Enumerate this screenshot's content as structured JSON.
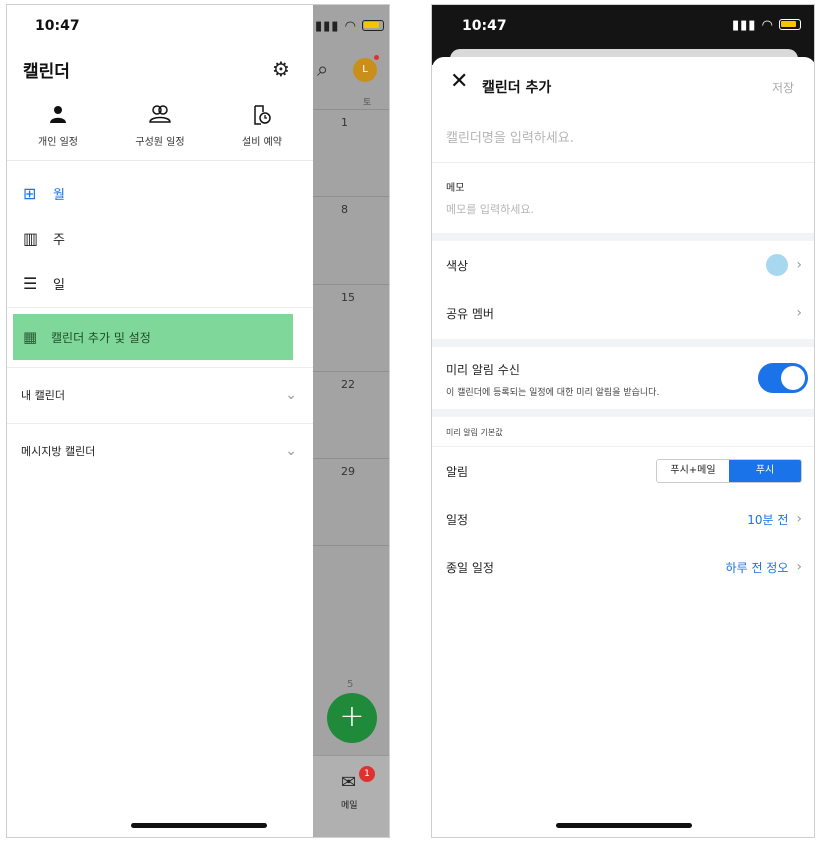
{
  "left": {
    "status": {
      "time": "10:47",
      "signal": "..ıl",
      "wifi": "◡"
    },
    "drawer": {
      "title": "캘린더",
      "shortcuts": [
        {
          "icon": "person-icon",
          "label": "개인 일정"
        },
        {
          "icon": "group-icon",
          "label": "구성원 일정"
        },
        {
          "icon": "equipment-icon",
          "label": "설비 예약"
        }
      ],
      "views": [
        {
          "icon": "month-view-icon",
          "label": "월",
          "active": true
        },
        {
          "icon": "week-view-icon",
          "label": "주",
          "active": false
        },
        {
          "icon": "day-view-icon",
          "label": "일",
          "active": false
        }
      ],
      "add_settings": "캘린더 추가 및 설정",
      "sections": [
        "내 캘린더",
        "메시지방 캘린더"
      ]
    },
    "background": {
      "avatar_initial": "L",
      "day_header": "토",
      "week_dates": [
        "1",
        "8",
        "15",
        "22",
        "29"
      ],
      "next_date": "5",
      "fab": "+",
      "mail_label": "메일",
      "mail_badge": "1"
    }
  },
  "right": {
    "status": {
      "time": "10:47"
    },
    "header": {
      "title": "캘린더 추가",
      "save": "저장"
    },
    "name_placeholder": "캘린더명을 입력하세요.",
    "memo": {
      "label": "메모",
      "placeholder": "메모를 입력하세요."
    },
    "color": {
      "label": "색상",
      "value": "#a8d8f0"
    },
    "share": {
      "label": "공유 멤버"
    },
    "notify": {
      "title": "미리 알림 수신",
      "desc": "이 캘린더에 등록되는 일정에 대한 미리 알림을 받습니다.",
      "enabled": true
    },
    "defaults_header": "미리 알림 기본값",
    "alarm": {
      "label": "알림",
      "options": [
        "푸시+메일",
        "푸시"
      ],
      "selected": "푸시"
    },
    "schedule": {
      "label": "일정",
      "value": "10분 전"
    },
    "allday": {
      "label": "종일 일정",
      "value": "하루 전 정오"
    }
  },
  "colors": {
    "accent": "#1a73e8",
    "highlight": "#7fd89a",
    "fab": "#1f8b3a",
    "badge": "#e03131"
  }
}
